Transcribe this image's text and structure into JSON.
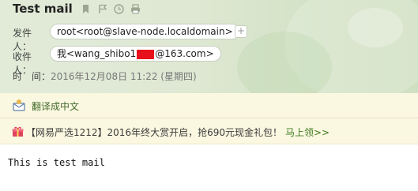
{
  "email": {
    "subject": "Test mail",
    "from_label": "发件人：",
    "from_value": "root<root@slave-node.localdomain>",
    "add_contact_symbol": "+",
    "to_label": "收件人：",
    "to_prefix": "我<wang_shibo1",
    "to_suffix": "@163.com>",
    "time_label": "时　间：",
    "time_value": "2016年12月08日 11:22 (星期四)"
  },
  "translate": {
    "label": "翻译成中文"
  },
  "ad": {
    "text": "【网易严选1212】2016年终大赏开启，抢690元现金礼包！",
    "link": "马上领>>"
  },
  "body": {
    "text": "This is test mail"
  },
  "icons": [
    "bookmark-icon",
    "flag-icon",
    "clock-icon",
    "print-icon",
    "translate-icon",
    "gift-icon"
  ]
}
